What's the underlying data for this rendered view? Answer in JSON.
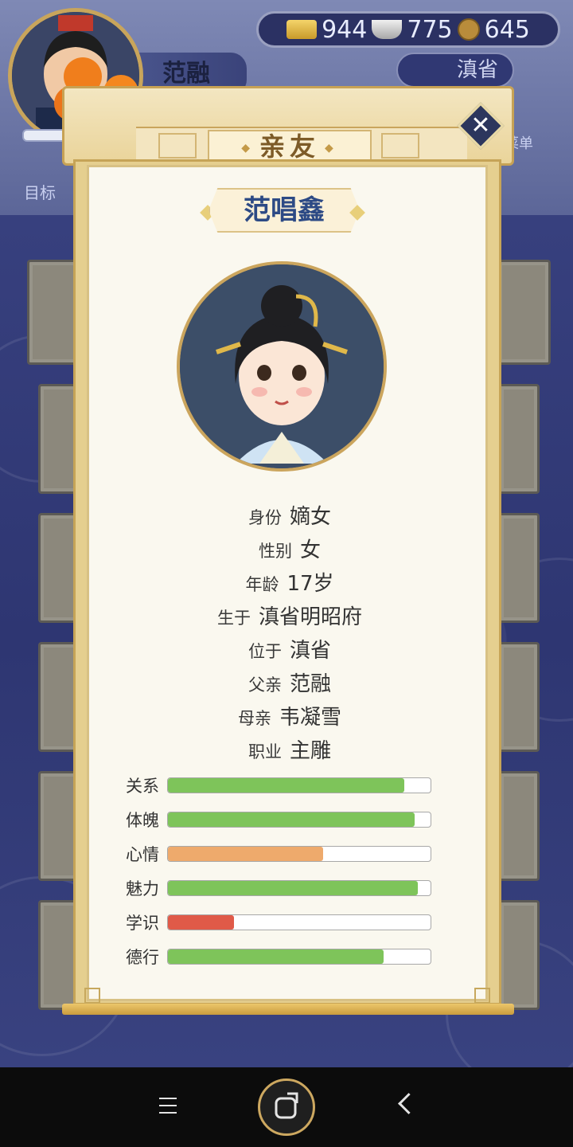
{
  "hud": {
    "player_name": "范融",
    "gold": "944",
    "silver": "775",
    "coins": "645",
    "region": "滇省",
    "goal_label": "目标",
    "menu_label": "菜单"
  },
  "dialog": {
    "title": "亲友",
    "person_name": "范唱鑫",
    "info": [
      {
        "key": "身份",
        "value": "嫡女"
      },
      {
        "key": "性别",
        "value": "女"
      },
      {
        "key": "年龄",
        "value": "17岁"
      },
      {
        "key": "生于",
        "value": "滇省明昭府"
      },
      {
        "key": "位于",
        "value": "滇省"
      },
      {
        "key": "父亲",
        "value": "范融"
      },
      {
        "key": "母亲",
        "value": "韦凝雪"
      },
      {
        "key": "职业",
        "value": "主雕"
      }
    ],
    "stats": [
      {
        "label": "关系",
        "value": 0.9,
        "color": "#7ec45a"
      },
      {
        "label": "体魄",
        "value": 0.94,
        "color": "#7ec45a"
      },
      {
        "label": "心情",
        "value": 0.59,
        "color": "#eeaa6c"
      },
      {
        "label": "魅力",
        "value": 0.95,
        "color": "#7ec45a"
      },
      {
        "label": "学识",
        "value": 0.25,
        "color": "#e05a48"
      },
      {
        "label": "德行",
        "value": 0.82,
        "color": "#7ec45a"
      }
    ]
  },
  "colors": {
    "accent_gold": "#c7a255",
    "paper": "#faf8ef",
    "name_blue": "#2d4a85"
  }
}
